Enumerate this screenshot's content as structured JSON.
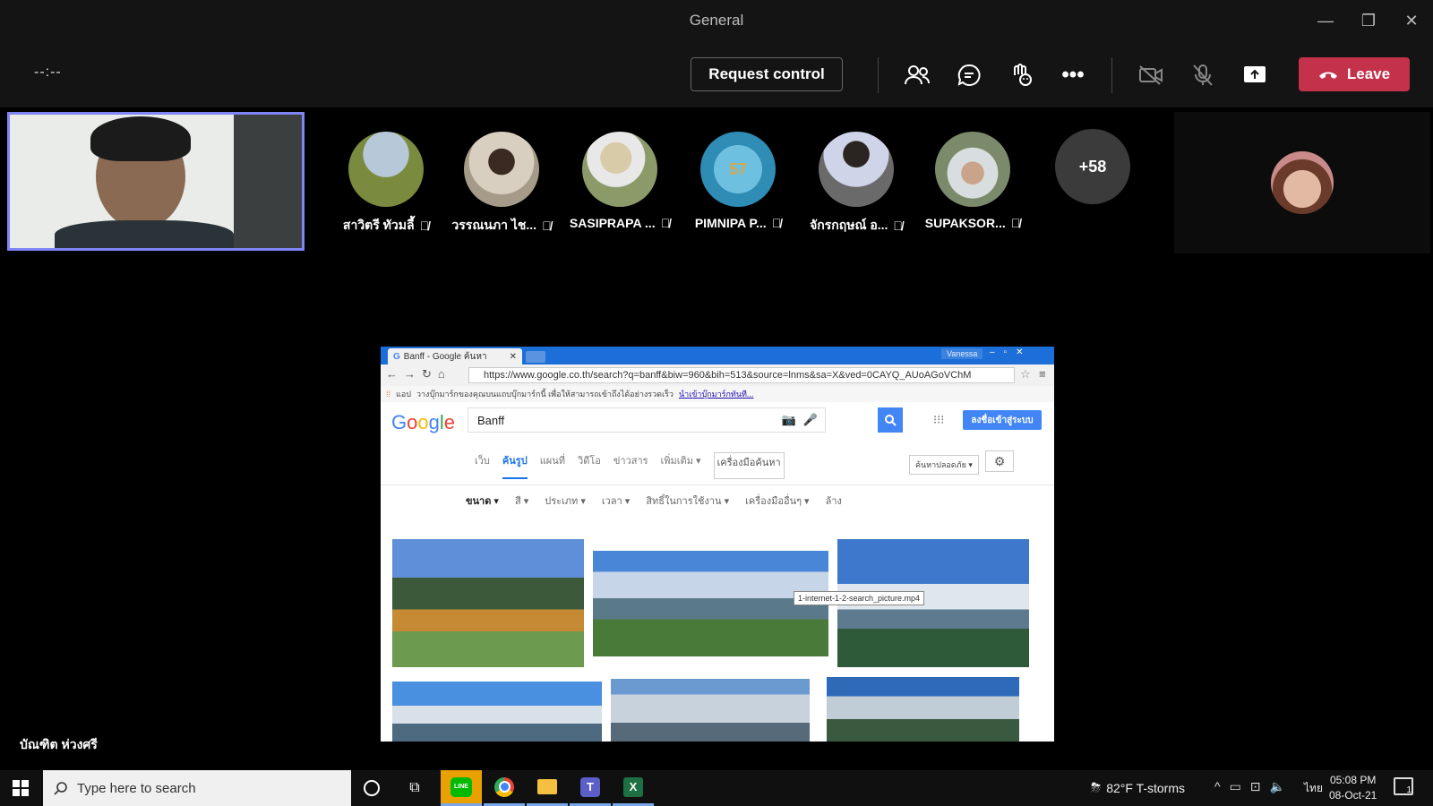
{
  "window": {
    "title": "General"
  },
  "toolbar": {
    "timer": "--:--",
    "request_control": "Request control",
    "leave": "Leave"
  },
  "participants": [
    {
      "name": "สาวิตรี ทัวมลี้",
      "color": "#7a8a3e"
    },
    {
      "name": "วรรณนภา ไช...",
      "color": "#a69a88"
    },
    {
      "name": "SASIPRAPA ...",
      "color": "#8c9a6a"
    },
    {
      "name": "PIMNIPA P...",
      "initials": "57",
      "color": "#2e8cb5"
    },
    {
      "name": "จักรกฤษณ์ อ...",
      "color": "#6a6a6a"
    },
    {
      "name": "SUPAKSOR...",
      "color": "#7a8a6a"
    }
  ],
  "more_count": "+58",
  "presenter_name": "บัณฑิต ห่วงศรี",
  "shared": {
    "tab_title": "Banff - Google ค้นหา",
    "user": "Vanessa",
    "url": "https://www.google.co.th/search?q=banff&biw=960&bih=513&source=lnms&sa=X&ved=0CAYQ_AUoAGoVChM",
    "bookmarks_app": "แอป",
    "bookmarks_text": "วางบุ๊กมาร์กของคุณบนแถบบุ๊กมาร์กนี้ เพื่อให้สามารถเข้าถึงได้อย่างรวดเร็ว",
    "bookmarks_link": "นำเข้าบุ๊กมาร์กทันที...",
    "query": "Banff",
    "signin": "ลงชื่อเข้าสู่ระบบ",
    "tabs": [
      "เว็บ",
      "ค้นรูป",
      "แผนที่",
      "วิดีโอ",
      "ข่าวสาร",
      "เพิ่มเติม ▾",
      "เครื่องมือค้นหา"
    ],
    "safesearch": "ค้นหาปลอดภัย ▾",
    "filters": [
      "ขนาด ▾",
      "สี ▾",
      "ประเภท ▾",
      "เวลา ▾",
      "สิทธิ์ในการใช้งาน ▾",
      "เครื่องมืออื่นๆ ▾",
      "ล้าง"
    ],
    "tooltip": "1-internet-1-2-search_picture.mp4"
  },
  "taskbar": {
    "search_placeholder": "Type here to search",
    "weather": "82°F  T-storms",
    "lang": "ไทย",
    "time": "05:08 PM",
    "date": "08-Oct-21",
    "notif": "1"
  }
}
